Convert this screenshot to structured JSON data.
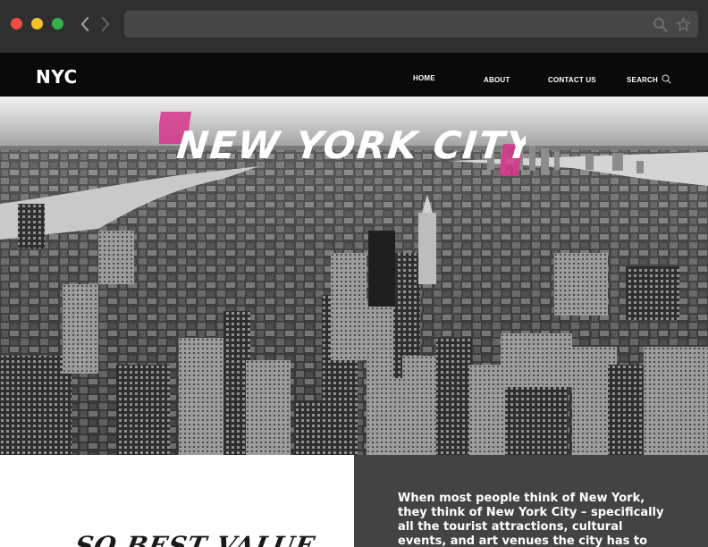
{
  "site": {
    "logo": "NYC",
    "menu": {
      "home": "HOME",
      "about": "ABOUT",
      "contact": "CONTACT US",
      "search": "SEARCH"
    }
  },
  "hero": {
    "title": "NEW YORK CITY",
    "accent_color": "#d6368a"
  },
  "content": {
    "heading": "SO BEST VALUE",
    "intro": "When most people think of New York, they think of New York City – specifically all the tourist attractions, cultural events, and art venues the city has to offer. But what many"
  },
  "icons": {
    "back": "chevron-left-icon",
    "forward": "chevron-right-icon",
    "url_search": "search-icon",
    "bookmark": "star-icon",
    "menu_search": "search-icon"
  }
}
